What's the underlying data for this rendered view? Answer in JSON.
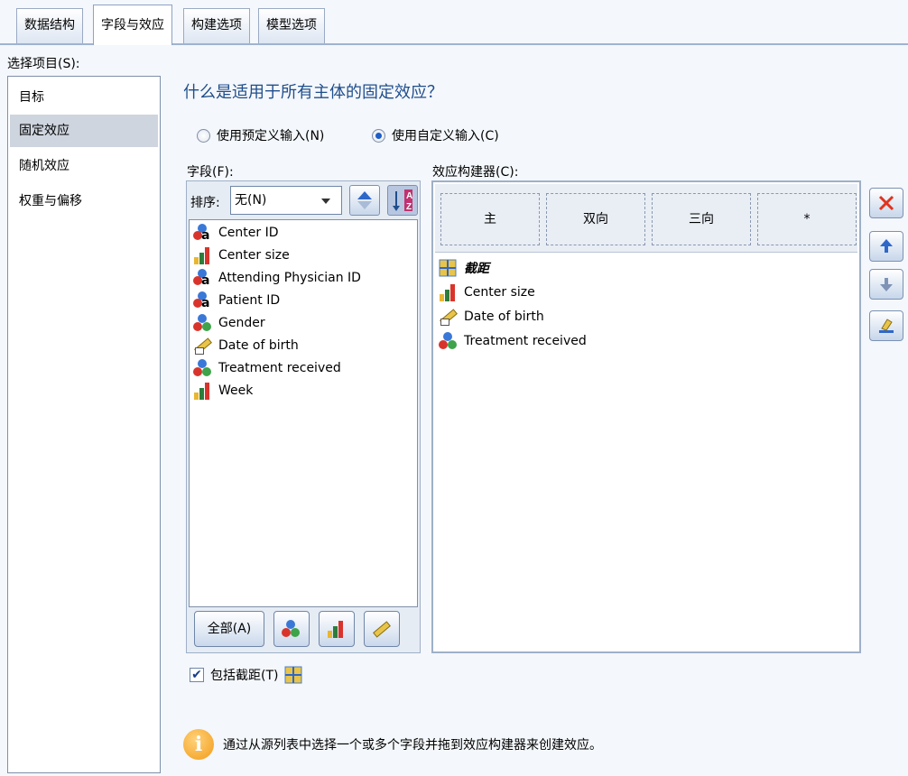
{
  "tabs": [
    {
      "label": "数据结构"
    },
    {
      "label": "字段与效应"
    },
    {
      "label": "构建选项"
    },
    {
      "label": "模型选项"
    }
  ],
  "sidebar": {
    "label": "选择项目(S):",
    "items": [
      {
        "label": "目标"
      },
      {
        "label": "固定效应"
      },
      {
        "label": "随机效应"
      },
      {
        "label": "权重与偏移"
      }
    ]
  },
  "main": {
    "heading": "什么是适用于所有主体的固定效应？",
    "radio_predefined": "使用预定义输入(N)",
    "radio_custom": "使用自定义输入(C)",
    "fields_label": "字段(F):",
    "sort_label": "排序:",
    "sort_value": "无(N)",
    "fields": [
      {
        "name": "Center ID",
        "icon": "nominal-string-icon"
      },
      {
        "name": "Center size",
        "icon": "ordinal-icon"
      },
      {
        "name": "Attending Physician ID",
        "icon": "nominal-string-icon"
      },
      {
        "name": "Patient ID",
        "icon": "nominal-string-icon"
      },
      {
        "name": "Gender",
        "icon": "nominal-icon"
      },
      {
        "name": "Date of birth",
        "icon": "scale-date-icon"
      },
      {
        "name": "Treatment received",
        "icon": "nominal-icon"
      },
      {
        "name": "Week",
        "icon": "ordinal-icon"
      }
    ],
    "all_button": "全部(A)",
    "effect_builder_label": "效应构建器(C):",
    "builder_headers": [
      "主",
      "双向",
      "三向",
      "*"
    ],
    "terms": [
      {
        "name": "截距",
        "icon": "intercept-icon"
      },
      {
        "name": "Center size",
        "icon": "ordinal-icon"
      },
      {
        "name": "Date of birth",
        "icon": "scale-date-icon"
      },
      {
        "name": "Treatment received",
        "icon": "nominal-icon"
      }
    ],
    "include_intercept": "包括截距(T)",
    "include_intercept_checked": true,
    "info_text": "通过从源列表中选择一个或多个字段并拖到效应构建器来创建效应。"
  },
  "colors": {
    "heading": "#1f4e8c",
    "delete": "#e0331e",
    "arrow": "#2f67c9"
  }
}
